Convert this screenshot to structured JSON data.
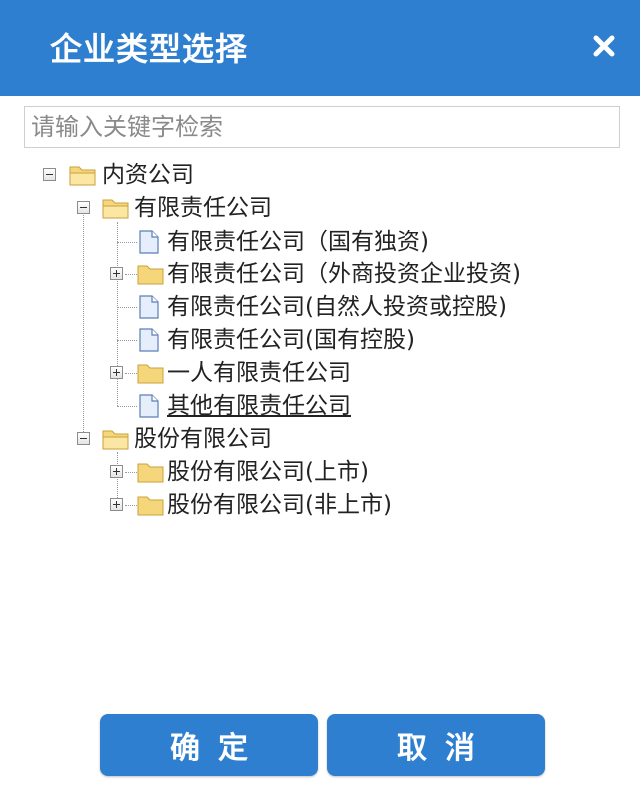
{
  "dialog": {
    "title": "企业类型选择",
    "close_icon": "close-icon"
  },
  "search": {
    "placeholder": "请输入关键字检索",
    "value": ""
  },
  "tree": {
    "n1": "内资公司",
    "n1_1": "有限责任公司",
    "n1_1_1": "有限责任公司（国有独资)",
    "n1_1_2": "有限责任公司（外商投资企业投资)",
    "n1_1_3": "有限责任公司(自然人投资或控股)",
    "n1_1_4": "有限责任公司(国有控股)",
    "n1_1_5": "一人有限责任公司",
    "n1_1_6": "其他有限责任公司",
    "n1_2": "股份有限公司",
    "n1_2_1": "股份有限公司(上市)",
    "n1_2_2": "股份有限公司(非上市)"
  },
  "buttons": {
    "confirm": "确定",
    "cancel": "取消"
  },
  "colors": {
    "primary": "#2f7fd0",
    "folder": "#f6d67a",
    "file": "#e6eefb"
  }
}
